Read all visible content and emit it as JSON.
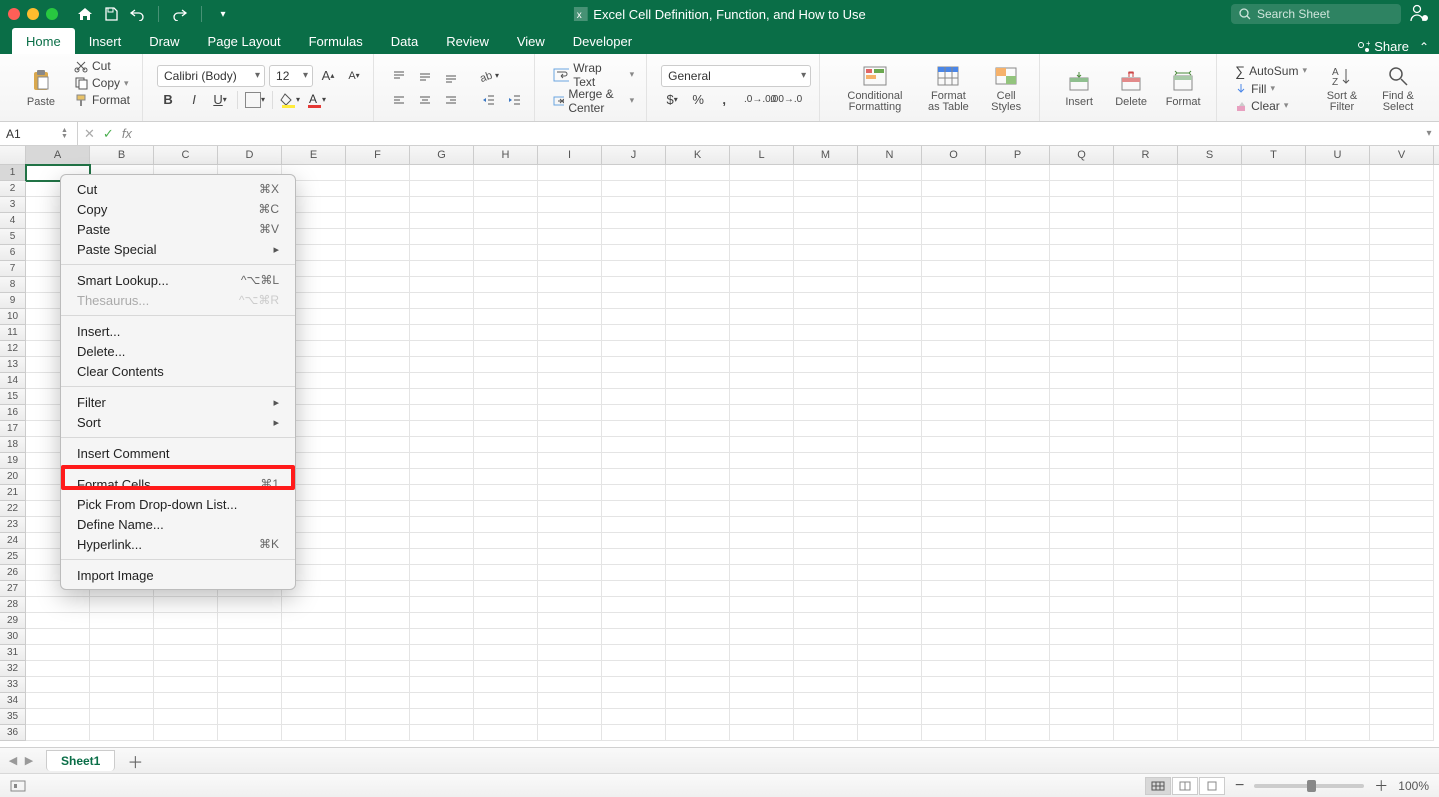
{
  "title_bar": {
    "document_title": "Excel Cell Definition, Function, and How to Use",
    "search_placeholder": "Search Sheet"
  },
  "ribbon_tabs": [
    "Home",
    "Insert",
    "Draw",
    "Page Layout",
    "Formulas",
    "Data",
    "Review",
    "View",
    "Developer"
  ],
  "active_tab": "Home",
  "share_label": "Share",
  "clipboard": {
    "paste": "Paste",
    "cut": "Cut",
    "copy": "Copy",
    "format": "Format"
  },
  "font": {
    "name": "Calibri (Body)",
    "size": "12"
  },
  "alignment": {
    "wrap": "Wrap Text",
    "merge": "Merge & Center"
  },
  "number": {
    "format": "General"
  },
  "styles": {
    "cond": "Conditional Formatting",
    "table": "Format as Table",
    "cell": "Cell Styles"
  },
  "cells": {
    "insert": "Insert",
    "delete": "Delete",
    "format": "Format"
  },
  "editing": {
    "autosum": "AutoSum",
    "fill": "Fill",
    "clear": "Clear",
    "sort": "Sort & Filter",
    "find": "Find & Select"
  },
  "name_box": "A1",
  "fx_label": "fx",
  "columns": [
    "A",
    "B",
    "C",
    "D",
    "E",
    "F",
    "G",
    "H",
    "I",
    "J",
    "K",
    "L",
    "M",
    "N",
    "O",
    "P",
    "Q",
    "R",
    "S",
    "T",
    "U",
    "V"
  ],
  "row_count": 36,
  "selected_cell": {
    "row": 1,
    "col": "A"
  },
  "context_menu": {
    "groups": [
      [
        {
          "label": "Cut",
          "shortcut": "⌘X"
        },
        {
          "label": "Copy",
          "shortcut": "⌘C"
        },
        {
          "label": "Paste",
          "shortcut": "⌘V"
        },
        {
          "label": "Paste Special",
          "submenu": true
        }
      ],
      [
        {
          "label": "Smart Lookup...",
          "shortcut": "^⌥⌘L"
        },
        {
          "label": "Thesaurus...",
          "shortcut": "^⌥⌘R",
          "disabled": true
        }
      ],
      [
        {
          "label": "Insert..."
        },
        {
          "label": "Delete..."
        },
        {
          "label": "Clear Contents"
        }
      ],
      [
        {
          "label": "Filter",
          "submenu": true
        },
        {
          "label": "Sort",
          "submenu": true
        }
      ],
      [
        {
          "label": "Insert Comment"
        }
      ],
      [
        {
          "label": "Format Cells...",
          "shortcut": "⌘1"
        },
        {
          "label": "Pick From Drop-down List..."
        },
        {
          "label": "Define Name..."
        },
        {
          "label": "Hyperlink...",
          "shortcut": "⌘K"
        }
      ],
      [
        {
          "label": "Import Image"
        }
      ]
    ]
  },
  "sheet_tabs": [
    "Sheet1"
  ],
  "status": {
    "zoom": "100%"
  }
}
